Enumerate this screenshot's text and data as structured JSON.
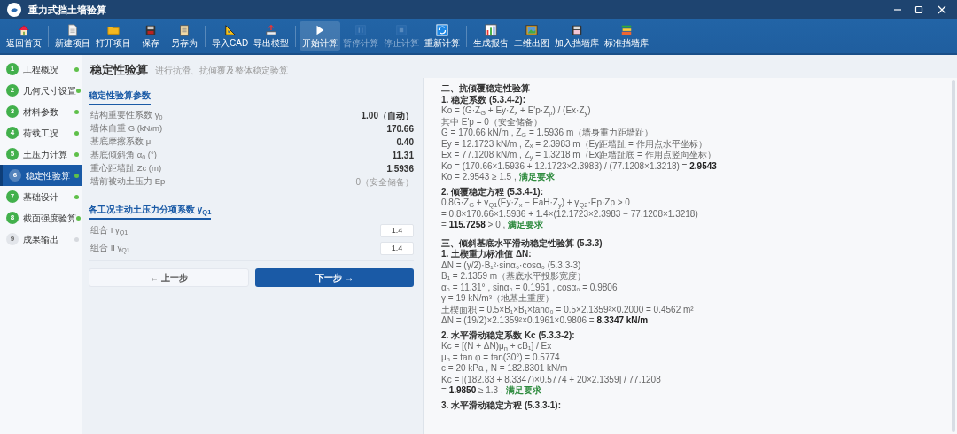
{
  "window": {
    "title": "重力式挡土墙验算"
  },
  "toolbar": {
    "groups": [
      {
        "buttons": [
          {
            "label": "返回首页",
            "disabled": false,
            "active": false
          }
        ]
      },
      {
        "buttons": [
          {
            "label": "新建项目",
            "disabled": false,
            "active": false
          },
          {
            "label": "打开项目",
            "disabled": false,
            "active": false
          },
          {
            "label": "保存",
            "disabled": false,
            "active": false
          },
          {
            "label": "另存为",
            "disabled": false,
            "active": false
          }
        ]
      },
      {
        "buttons": [
          {
            "label": "导入CAD",
            "disabled": false,
            "active": false
          },
          {
            "label": "导出模型",
            "disabled": false,
            "active": false
          }
        ]
      },
      {
        "buttons": [
          {
            "label": "开始计算",
            "disabled": false,
            "active": true
          },
          {
            "label": "暂停计算",
            "disabled": true,
            "active": false
          },
          {
            "label": "停止计算",
            "disabled": true,
            "active": false
          },
          {
            "label": "重新计算",
            "disabled": false,
            "active": false
          }
        ]
      },
      {
        "buttons": [
          {
            "label": "生成报告",
            "disabled": false,
            "active": false
          },
          {
            "label": "二维出图",
            "disabled": false,
            "active": false
          },
          {
            "label": "加入挡墙库",
            "disabled": false,
            "active": false
          },
          {
            "label": "标准挡墙库",
            "disabled": false,
            "active": false
          }
        ]
      }
    ]
  },
  "sidebar": {
    "items": [
      {
        "number": "1",
        "label": "工程概况",
        "selected": false,
        "done": true
      },
      {
        "number": "2",
        "label": "几何尺寸设置",
        "selected": false,
        "done": true
      },
      {
        "number": "3",
        "label": "材料参数",
        "selected": false,
        "done": true
      },
      {
        "number": "4",
        "label": "荷载工况",
        "selected": false,
        "done": true
      },
      {
        "number": "5",
        "label": "土压力计算",
        "selected": false,
        "done": true
      },
      {
        "number": "6",
        "label": "稳定性验算",
        "selected": true,
        "done": true
      },
      {
        "number": "7",
        "label": "基础设计",
        "selected": false,
        "done": true
      },
      {
        "number": "8",
        "label": "截面强度验算",
        "selected": false,
        "done": true
      },
      {
        "number": "9",
        "label": "成果输出",
        "selected": false,
        "done": false
      }
    ]
  },
  "page": {
    "title": "稳定性验算",
    "subtitle": "进行抗滑、抗倾覆及整体稳定验算"
  },
  "parameters": {
    "title": "稳定性验算参数",
    "rows": [
      {
        "label": "结构重要性系数 γ$_{0}$",
        "value": "1.00（自动）",
        "emphasis": true
      },
      {
        "label": "墙体自重 G (kN/m)",
        "value": "170.66",
        "emphasis": true
      },
      {
        "label": "基底摩擦系数 μ",
        "value": "0.40",
        "emphasis": true
      },
      {
        "label": "基底倾斜角 α$_{0}$ (°)",
        "value": "11.31",
        "emphasis": true
      },
      {
        "label": "重心距墙趾 Zc (m)",
        "value": "1.5936",
        "emphasis": true
      },
      {
        "label": "墙前被动土压力 Ep",
        "value": "0（安全储备）",
        "emphasis": false
      }
    ]
  },
  "factors": {
    "title": "各工况主动土压力分项系数 γ$_{Q1}$",
    "rows": [
      {
        "label": "组合 I γ$_{Q1}$",
        "value": "1.4"
      },
      {
        "label": "组合 II γ$_{Q1}$",
        "value": "1.4"
      }
    ]
  },
  "buttons": [
    {
      "label": "← 上一步",
      "kind": "secondary"
    },
    {
      "label": "下一步 →",
      "kind": "primary"
    }
  ],
  "report": [
    {
      "heading": "二、抗倾覆稳定性验算",
      "steps": [
        {
          "title": "1. 稳定系数 (5.3.4-2):",
          "lines": [
            {
              "text": "Ko = (G·Z$_{G}$ + Ey·Z$_{x}$ + E'p·Z$_{p}$) / (Ex·Z$_{y}$)"
            },
            {
              "text": "其中 E'p = 0（安全储备）"
            },
            {
              "text": "G = 170.66 kN/m , Z$_{G}$ = 1.5936 m（墙身重力距墙趾）"
            },
            {
              "text": "Ey = 12.1723 kN/m , Z$_{x}$ = 2.3983 m（Ey距墙趾 = 作用点水平坐标）"
            },
            {
              "text": "Ex = 77.1208 kN/m , Z$_{y}$ = 1.3218 m（Ex距墙趾底 = 作用点竖向坐标）"
            },
            {
              "text": "Ko = (170.66×1.5936 + 12.1723×2.3983) / (77.1208×1.3218) = **2.9543**"
            },
            {
              "text": "Ko = 2.9543 ≥ 1.5 ,",
              "verdict": "满足要求"
            }
          ]
        },
        {
          "title": "2. 倾覆稳定方程 (5.3.4-1):",
          "lines": [
            {
              "text": "0.8G·Z$_{G}$ + γ$_{Q1}$(Ey·Z$_{x}$ − EaH·Z$_{y}$) + γ$_{Q2}$·Ep·Zp > 0"
            },
            {
              "text": "= 0.8×170.66×1.5936 + 1.4×(12.1723×2.3983 − 77.1208×1.3218)"
            },
            {
              "text": "= **115.7258** > 0 ,",
              "verdict": "满足要求"
            }
          ]
        }
      ]
    },
    {
      "heading": "三、倾斜基底水平滑动稳定性验算 (5.3.3)",
      "steps": [
        {
          "title": "1. 土楔重力标准值 ΔN:",
          "lines": [
            {
              "text": "ΔN = (γ/2)·B₁²·sinα₀·cosα₀ (5.3.3-3)"
            },
            {
              "text": "B₁ = 2.1359 m（基底水平投影宽度）"
            },
            {
              "text": "α₀ = 11.31° , sinα₀ = 0.1961 , cosα₀ = 0.9806"
            },
            {
              "text": "γ = 19 kN/m³（地基土重度）"
            },
            {
              "text": "土楔面积 = 0.5×B₁×B₁×tanα₀ = 0.5×2.1359²×0.2000 = 0.4562 m²"
            },
            {
              "text": "ΔN = (19/2)×2.1359²×0.1961×0.9806 = **8.3347 kN/m**"
            }
          ]
        },
        {
          "title": "2. 水平滑动稳定系数 Kc (5.3.3-2):",
          "lines": [
            {
              "text": "Kc = [(N + ΔN)μ$_{n}$ + cB₁] / Ex"
            },
            {
              "text": "μ$_{n}$ = tan φ = tan(30°) = 0.5774"
            },
            {
              "text": "c = 20 kPa , N = 182.8301 kN/m"
            },
            {
              "text": "Kc = [(182.83 + 8.3347)×0.5774 + 20×2.1359] / 77.1208"
            },
            {
              "text": "= **1.9850** ≥ 1.3 ,",
              "verdict": "满足要求"
            }
          ]
        },
        {
          "title": "3. 水平滑动稳定方程 (5.3.3-1):"
        }
      ]
    }
  ]
}
